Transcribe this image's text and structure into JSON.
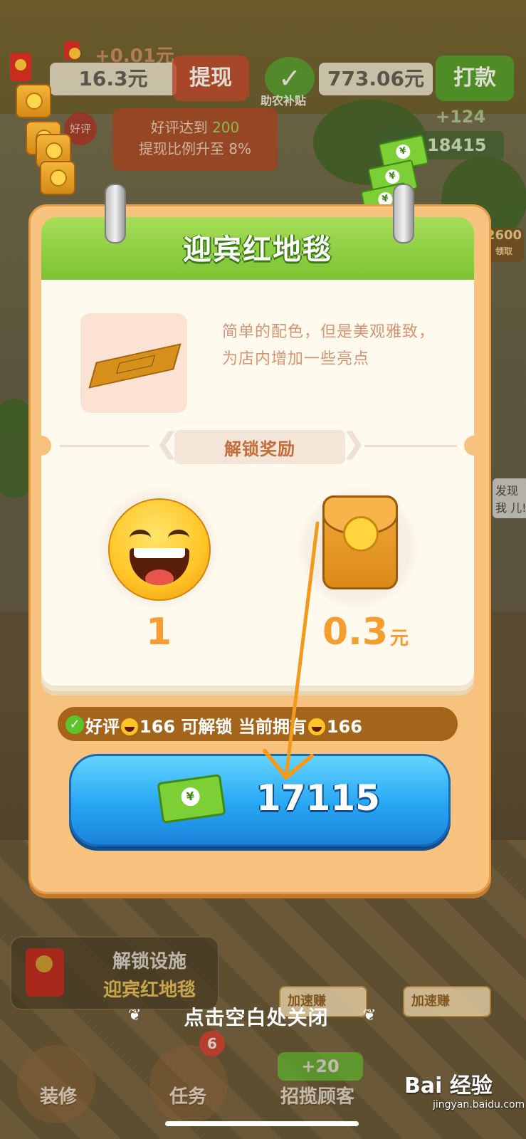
{
  "hud": {
    "plus_amount": "+0.01元",
    "balance": "16.3元",
    "withdraw_label": "提现",
    "subsidy_label": "助农补贴",
    "subsidy_amount": "773.06元",
    "pay_label": "打款",
    "good_review_badge": "好评",
    "review_hint_line1_pre": "好评达到",
    "review_hint_line1_num": "200",
    "review_hint_line2": "提现比例升至 8%",
    "cash_plus": "+124",
    "cash_total": "18415",
    "side_value": "2600",
    "side_label": "领取",
    "side_bubble": "发现我 儿!"
  },
  "panel": {
    "title": "迎宾红地毯",
    "description": "简单的配色，但是美观雅致，为店内增加一些亮点",
    "reward_section_label": "解锁奖励",
    "rewards": [
      {
        "icon": "smiley-face-icon",
        "value": "1",
        "unit": ""
      },
      {
        "icon": "red-envelope-icon",
        "value": "0.3",
        "unit": "元"
      }
    ],
    "requirement": {
      "prefix": "好评",
      "need": "166",
      "mid": "可解锁 当前拥有",
      "have": "166"
    },
    "buy_price": "17115"
  },
  "bottom": {
    "facility_line1": "解锁设施",
    "facility_line2": "迎宾红地毯",
    "close_hint": "点击空白处关闭",
    "speed_left": "加速赚",
    "speed_right": "加速赚",
    "nav_decor": "装修",
    "nav_tasks": "任务",
    "tasks_badge": "6",
    "recruit_bonus": "+20",
    "nav_recruit": "招揽顾客"
  },
  "watermark": {
    "brand": "Bai 经验",
    "url": "jingyan.baidu.com"
  },
  "colors": {
    "title_green": "#7cc232",
    "button_blue": "#27a6f2",
    "reward_orange": "#f49e2f",
    "panel_wood": "#f7c27e"
  }
}
